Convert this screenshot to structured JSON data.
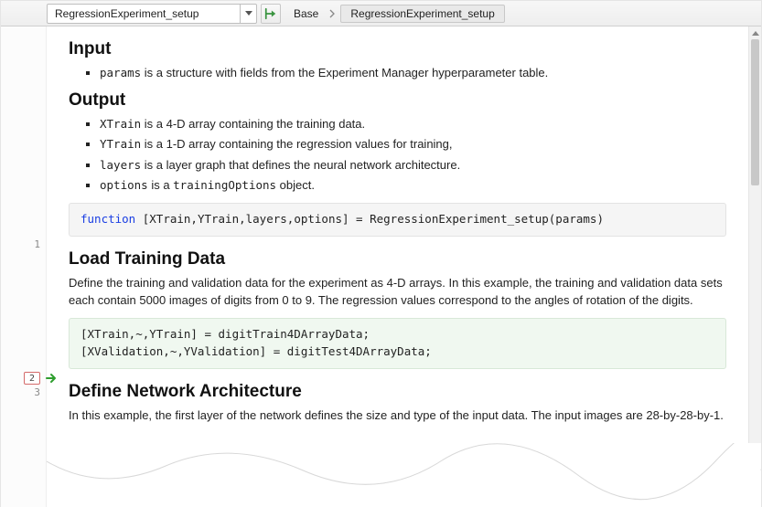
{
  "toolbar": {
    "function_selector": {
      "value": "RegressionExperiment_setup"
    },
    "breadcrumb": {
      "base": "Base",
      "current": "RegressionExperiment_setup"
    }
  },
  "gutter": {
    "lines": [
      "1",
      "2",
      "3"
    ]
  },
  "doc": {
    "input": {
      "heading": "Input",
      "items": [
        {
          "code": "params",
          "text": "is a structure with fields from the Experiment Manager hyperparameter table."
        }
      ]
    },
    "output": {
      "heading": "Output",
      "items": [
        {
          "code": "XTrain",
          "text": "is a 4-D array containing the training data."
        },
        {
          "code": "YTrain",
          "text": "is a 1-D array containing the regression values for training,"
        },
        {
          "code": "layers",
          "text": "is a layer graph that defines the neural network architecture."
        },
        {
          "code": "options",
          "text_pre": "is a ",
          "code2": "trainingOptions",
          "text_post": "object."
        }
      ]
    },
    "signature": {
      "keyword": "function",
      "rest": "[XTrain,YTrain,layers,options] = RegressionExperiment_setup(params)"
    },
    "load": {
      "heading": "Load Training Data",
      "para": "Define the training and validation data for the experiment as 4-D arrays. In this example, the training and validation data sets each contain 5000 images of digits from 0 to 9. The regression values correspond to the angles of rotation of the digits.",
      "code": [
        "[XTrain,~,YTrain] = digitTrain4DArrayData;",
        "[XValidation,~,YValidation] = digitTest4DArrayData;"
      ]
    },
    "arch": {
      "heading": "Define Network Architecture",
      "para": "In this example, the first layer of the network defines the size and type of the input data. The input images are 28-by-28-by-1."
    }
  }
}
